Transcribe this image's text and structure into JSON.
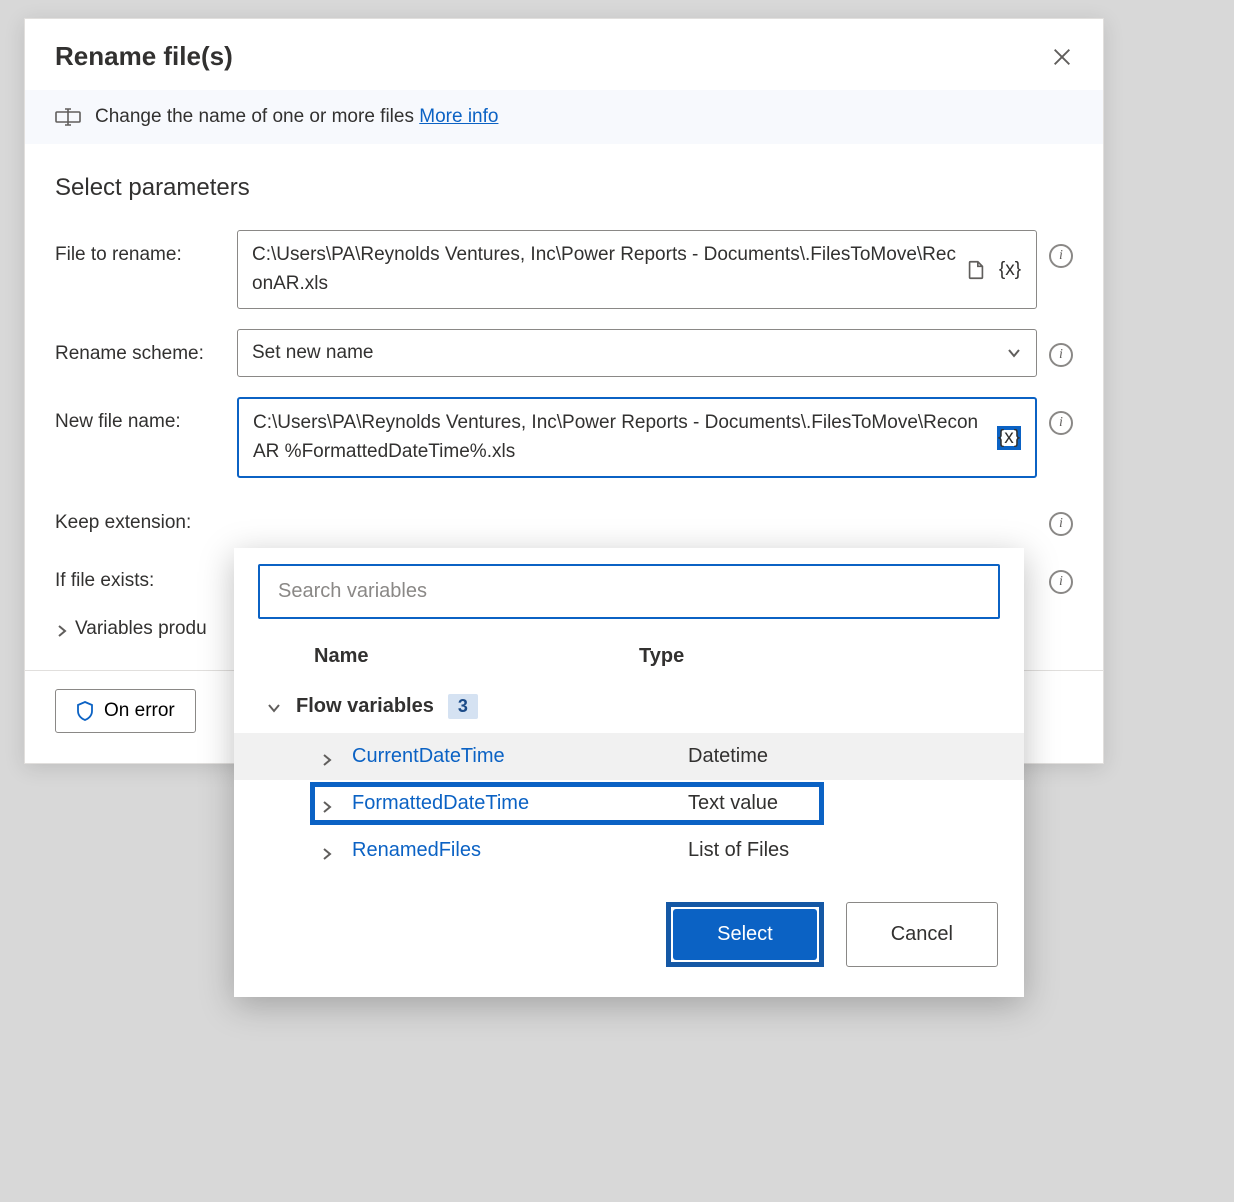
{
  "dialog": {
    "title": "Rename file(s)",
    "info_text": "Change the name of one or more files ",
    "info_link": "More info",
    "section_title": "Select parameters",
    "params": {
      "file_to_rename_label": "File to rename:",
      "file_to_rename_value": "C:\\Users\\PA\\Reynolds Ventures, Inc\\Power Reports - Documents\\.FilesToMove\\ReconAR.xls",
      "rename_scheme_label": "Rename scheme:",
      "rename_scheme_value": "Set new name",
      "new_file_name_label": "New file name:",
      "new_file_name_value": "C:\\Users\\PA\\Reynolds Ventures, Inc\\Power Reports - Documents\\.FilesToMove\\ReconAR %FormattedDateTime%.xls",
      "keep_extension_label": "Keep extension:",
      "if_file_exists_label": "If file exists:"
    },
    "variables_produced_label": "Variables produ",
    "on_error_label": "On error"
  },
  "popup": {
    "search_placeholder": "Search variables",
    "columns": {
      "name": "Name",
      "type": "Type"
    },
    "group": {
      "label": "Flow variables",
      "count": "3"
    },
    "rows": [
      {
        "name": "CurrentDateTime",
        "type": "Datetime"
      },
      {
        "name": "FormattedDateTime",
        "type": "Text value"
      },
      {
        "name": "RenamedFiles",
        "type": "List of Files"
      }
    ],
    "select_label": "Select",
    "cancel_label": "Cancel"
  },
  "glyphs": {
    "variable": "{x}",
    "info": "i"
  }
}
